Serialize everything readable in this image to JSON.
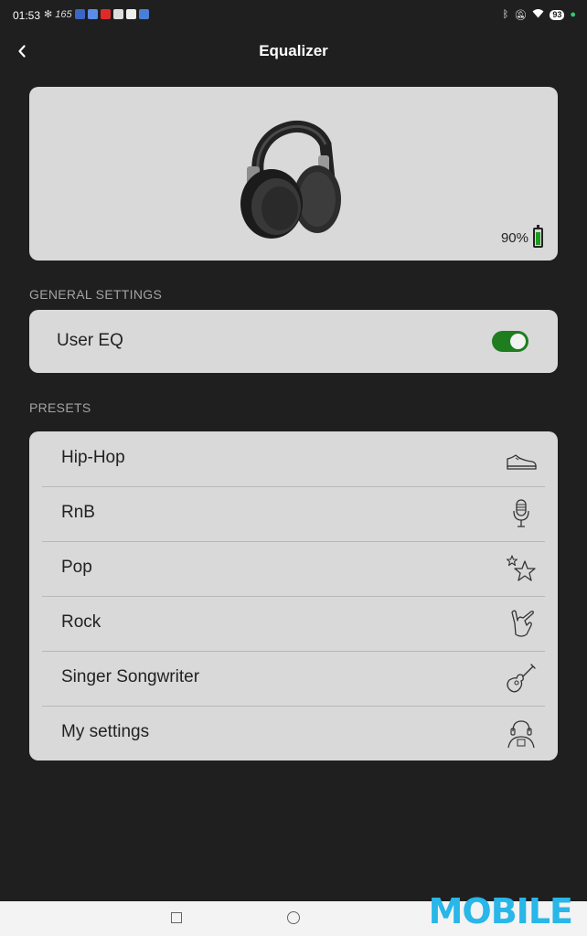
{
  "status_bar": {
    "time": "01:53",
    "left_icons": [
      "fan-icon",
      "data-speed-icon",
      "facebook-icon",
      "messenger-icon",
      "youtube-icon",
      "app-icon",
      "chat-icon",
      "play-icon"
    ],
    "data_speed": "165",
    "right_icons": [
      "bluetooth-icon",
      "mute-icon",
      "wifi-icon",
      "battery-icon",
      "charging-icon"
    ],
    "battery": "93"
  },
  "header": {
    "title": "Equalizer",
    "back_icon": "chevron-left-icon"
  },
  "device": {
    "battery_text": "90%",
    "battery_level": 0.9,
    "battery_color": "#1e9c1e"
  },
  "general": {
    "section_label": "GENERAL SETTINGS",
    "user_eq_label": "User EQ",
    "user_eq_on": true,
    "toggle_color": "#1e7d1e"
  },
  "presets": {
    "section_label": "PRESETS",
    "items": [
      {
        "label": "Hip-Hop",
        "icon": "sneaker-icon"
      },
      {
        "label": "RnB",
        "icon": "microphone-icon"
      },
      {
        "label": "Pop",
        "icon": "stars-icon"
      },
      {
        "label": "Rock",
        "icon": "rock-hand-icon"
      },
      {
        "label": "Singer Songwriter",
        "icon": "guitar-icon"
      },
      {
        "label": "My settings",
        "icon": "headphone-user-icon"
      }
    ]
  },
  "nav_bar": {
    "icons": [
      "recents-icon",
      "home-icon"
    ]
  },
  "watermark": "MOBILE"
}
